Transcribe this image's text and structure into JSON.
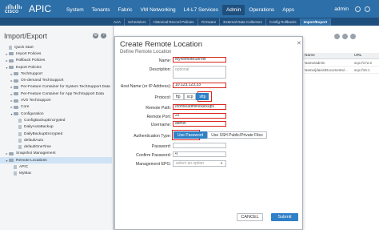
{
  "header": {
    "logo_text": "CISCO",
    "app_title": "APIC",
    "nav": [
      "System",
      "Tenants",
      "Fabric",
      "VM Networking",
      "L4-L7 Services",
      "Admin",
      "Operations",
      "Apps"
    ],
    "active_nav": "Admin",
    "user": "admin"
  },
  "subnav": {
    "items": [
      "AAA",
      "Schedulers",
      "Historical Record Policies",
      "Firmware",
      "External Data Collectors",
      "Config Rollbacks",
      "Import/Export"
    ],
    "active": "Import/Export"
  },
  "sidebar": {
    "title": "Import/Export",
    "items": [
      {
        "label": "Quick Start",
        "indent": 1,
        "caret": "",
        "icon": "quickstart"
      },
      {
        "label": "Import Policies",
        "indent": 1,
        "caret": "▸",
        "icon": "folder"
      },
      {
        "label": "Rollback Policies",
        "indent": 1,
        "caret": "▸",
        "icon": "folder"
      },
      {
        "label": "Export Policies",
        "indent": 1,
        "caret": "▾",
        "icon": "folder"
      },
      {
        "label": "TechSupport",
        "indent": 2,
        "caret": "▸",
        "icon": "folder"
      },
      {
        "label": "On-demand TechSupport",
        "indent": 2,
        "caret": "▸",
        "icon": "folder"
      },
      {
        "label": "Per-Feature Container for System TechSupport Data",
        "indent": 2,
        "caret": "▸",
        "icon": "folder"
      },
      {
        "label": "Per-Feature Container for App TechSupport Data",
        "indent": 2,
        "caret": "▸",
        "icon": "folder"
      },
      {
        "label": "AVS TechSupport",
        "indent": 2,
        "caret": "▸",
        "icon": "folder"
      },
      {
        "label": "Core",
        "indent": 2,
        "caret": "▸",
        "icon": "folder"
      },
      {
        "label": "Configuration",
        "indent": 2,
        "caret": "▾",
        "icon": "folder"
      },
      {
        "label": "ConfigBackupEncrypted",
        "indent": 3,
        "caret": "",
        "icon": "file"
      },
      {
        "label": "DailyAutoBackup",
        "indent": 3,
        "caret": "",
        "icon": "file"
      },
      {
        "label": "DailyBackupEncrypted",
        "indent": 3,
        "caret": "",
        "icon": "file"
      },
      {
        "label": "defaultAuto",
        "indent": 3,
        "caret": "",
        "icon": "file"
      },
      {
        "label": "defaultOneTime",
        "indent": 3,
        "caret": "",
        "icon": "file"
      },
      {
        "label": "Snapshot Management",
        "indent": 1,
        "caret": "▸",
        "icon": "folder"
      },
      {
        "label": "Remote Locations",
        "indent": 1,
        "caret": "▾",
        "icon": "folder",
        "selected": true
      },
      {
        "label": "APIC",
        "indent": 2,
        "caret": "",
        "icon": "file"
      },
      {
        "label": "MyMac",
        "indent": 2,
        "caret": "",
        "icon": "file"
      }
    ]
  },
  "background_table": {
    "headers": [
      "Name",
      "URL"
    ],
    "rows": [
      [
        "Name/admin",
        "scp://172.2"
      ],
      [
        "Name/jdavis/Documents/...",
        "scp://10.1"
      ]
    ]
  },
  "dialog": {
    "title": "Create Remote Location",
    "subtitle": "Define Remote Location",
    "name_label": "Name:",
    "name_value": "MyRemoteServer",
    "description_label": "Description:",
    "description_placeholder": "optional",
    "host_label": "Host Name (or IP Address):",
    "host_value": "10.123.123.33",
    "protocol_label": "Protocol:",
    "protocols": [
      "ftp",
      "scp",
      "sftp"
    ],
    "protocol_selected": "sftp",
    "path_label": "Remote Path:",
    "path_value": "/home/admin/backups",
    "port_label": "Remote Port:",
    "port_value": "22",
    "username_label": "Username:",
    "username_value": "admin",
    "auth_label": "Authentication Type:",
    "auth_options": [
      "Use Password",
      "Use SSH Public/Private Files"
    ],
    "auth_selected": "Use Password",
    "password_label": "Password:",
    "confirm_label": "Confirm Password:",
    "confirm_value": "•|",
    "epg_label": "Management EPG:",
    "epg_placeholder": "select an option",
    "cancel_label": "CANCEL",
    "submit_label": "Submit"
  }
}
